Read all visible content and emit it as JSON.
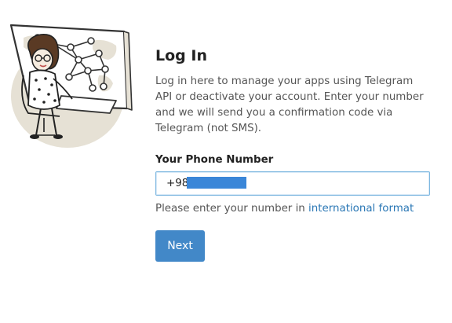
{
  "login": {
    "title": "Log In",
    "description": "Log in here to manage your apps using Telegram API or deactivate your account. Enter your number and we will send you a confirmation code via Telegram (not SMS).",
    "phone_label": "Your Phone Number",
    "phone_value": "+98",
    "hint_prefix": "Please enter your number in ",
    "hint_link": "international format",
    "next_label": "Next"
  },
  "illustration": {
    "icon": "woman-at-network-screen-illustration"
  },
  "colors": {
    "accent": "#4288c8",
    "link": "#2a77b5",
    "input_focus_border": "#7db7e0",
    "redaction": "#3a86d8"
  }
}
